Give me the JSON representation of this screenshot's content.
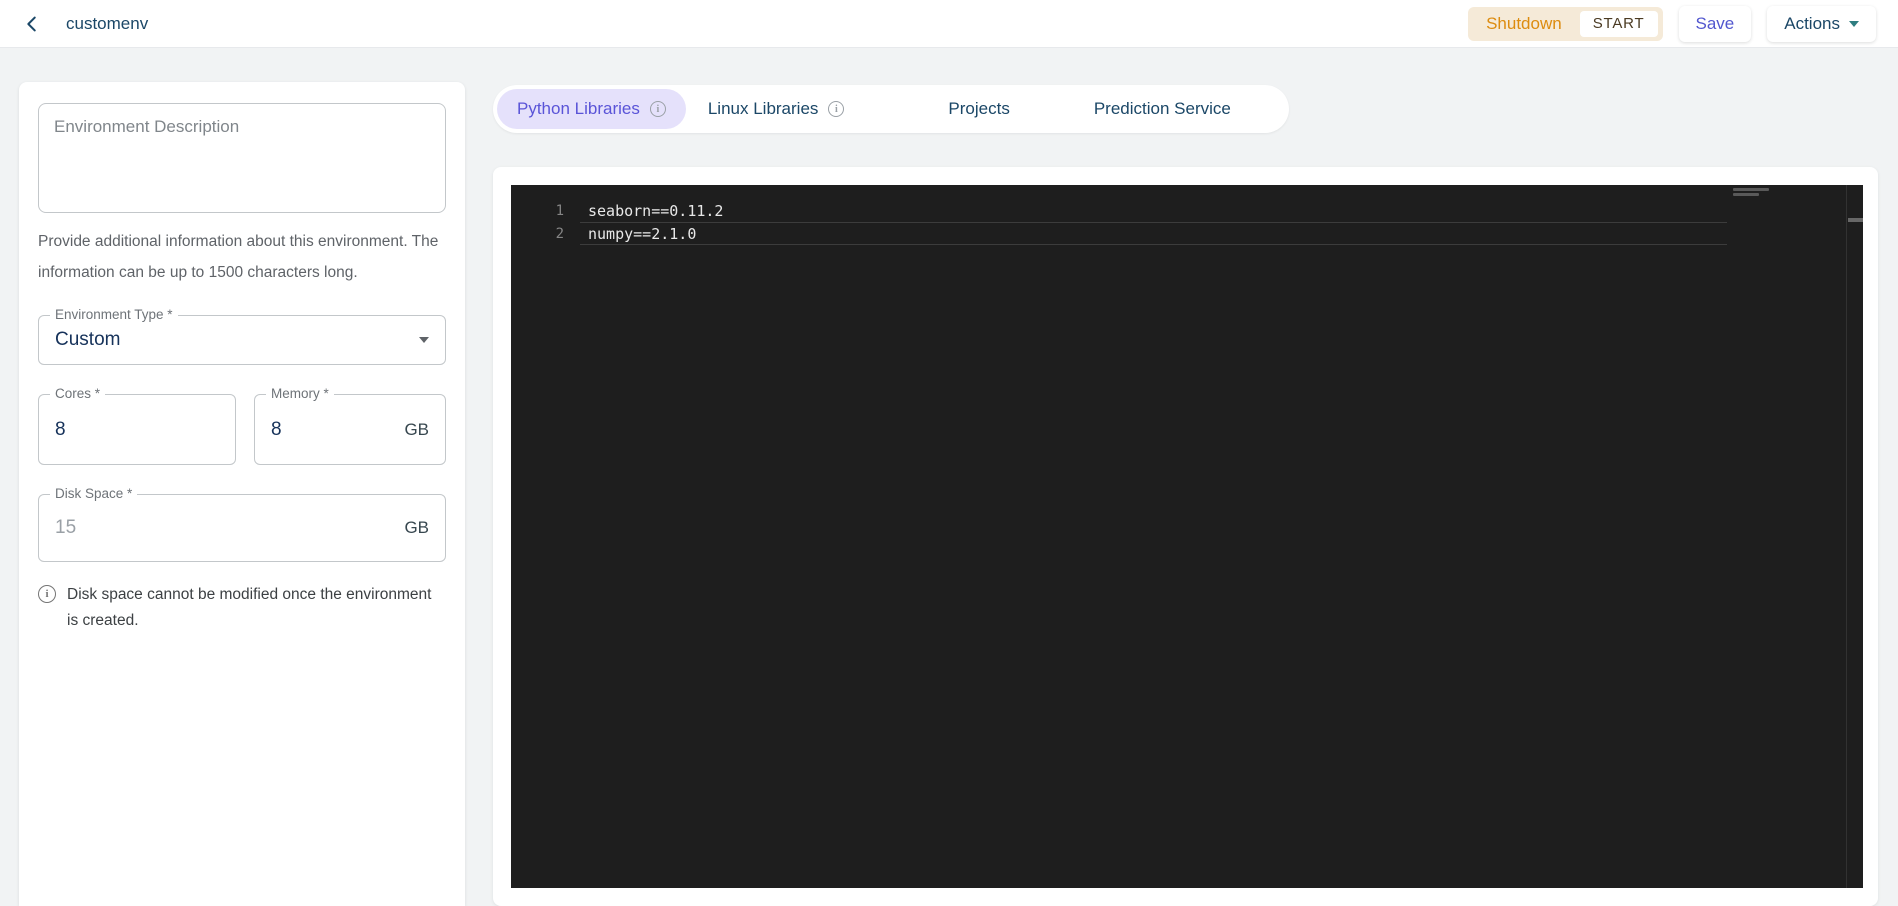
{
  "topbar": {
    "title": "customenv",
    "shutdown_label": "Shutdown",
    "start_label": "START",
    "save_label": "Save",
    "actions_label": "Actions"
  },
  "sidebar": {
    "description_placeholder": "Environment Description",
    "description_helper": "Provide additional information about this environment. The information can be up to 1500 characters long.",
    "environment_type": {
      "label": "Environment Type *",
      "value": "Custom"
    },
    "cores": {
      "label": "Cores *",
      "value": "8"
    },
    "memory": {
      "label": "Memory *",
      "value": "8",
      "suffix": "GB"
    },
    "disk_space": {
      "label": "Disk Space *",
      "value": "15",
      "suffix": "GB"
    },
    "disk_note": "Disk space cannot be modified once the environment is created."
  },
  "tabs": [
    {
      "label": "Python Libraries",
      "selected": true,
      "has_info_icon": true
    },
    {
      "label": "Linux Libraries",
      "selected": false,
      "has_info_icon": true
    },
    {
      "label": "Projects",
      "selected": false,
      "has_info_icon": false
    },
    {
      "label": "Prediction Service",
      "selected": false,
      "has_info_icon": false
    }
  ],
  "editor": {
    "language": "requirements",
    "active_line": 2,
    "lines": [
      {
        "number": "1",
        "code": "seaborn==0.11.2"
      },
      {
        "number": "2",
        "code": "numpy==2.1.0"
      }
    ]
  },
  "colors": {
    "page_bg": "#f1f3f4",
    "navy_text": "#1b4767",
    "accent_purple": "#5a54d8",
    "tab_pill_bg": "#e5e1fb",
    "save_indigo": "#5257cf",
    "shutdown_orange": "#dd8c0f",
    "segment_bg": "#f5ead8",
    "actions_caret_teal": "#2e7d80",
    "editor_bg": "#1e1e1e"
  }
}
